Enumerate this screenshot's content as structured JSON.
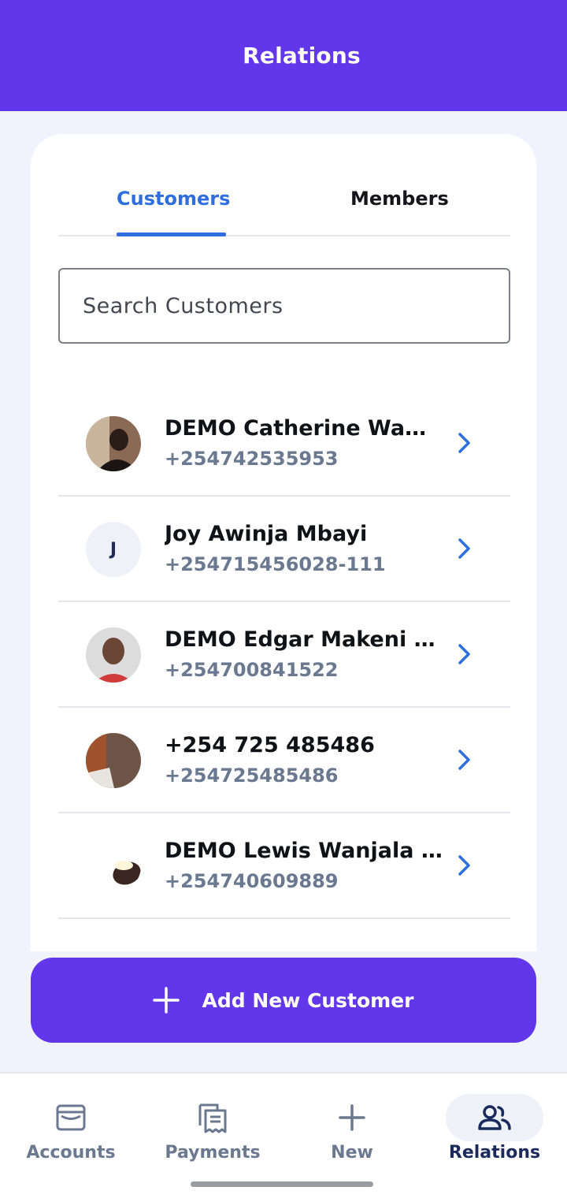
{
  "header": {
    "title": "Relations"
  },
  "tabs": [
    {
      "label": "Customers",
      "active": true
    },
    {
      "label": "Members",
      "active": false
    }
  ],
  "search": {
    "placeholder": "Search Customers",
    "value": ""
  },
  "customers": [
    {
      "name": "DEMO Catherine  Wam...",
      "phone": "+254742535953",
      "avatar": "photo"
    },
    {
      "name": "Joy Awinja Mbayi",
      "phone": "+254715456028-111",
      "avatar": "initial",
      "initial": "J"
    },
    {
      "name": "DEMO Edgar Makeni O...",
      "phone": "+254700841522",
      "avatar": "photo"
    },
    {
      "name": "+254 725 485486",
      "phone": "+254725485486",
      "avatar": "photo"
    },
    {
      "name": "DEMO Lewis Wanjala S...",
      "phone": "+254740609889",
      "avatar": "photo"
    }
  ],
  "add_button": {
    "label": "Add New Customer",
    "icon": "plus-icon"
  },
  "bottom_nav": [
    {
      "label": "Accounts",
      "icon": "wallet-icon",
      "active": false
    },
    {
      "label": "Payments",
      "icon": "receipts-icon",
      "active": false
    },
    {
      "label": "New",
      "icon": "plus-icon",
      "active": false
    },
    {
      "label": "Relations",
      "icon": "people-icon",
      "active": true
    }
  ],
  "colors": {
    "brand": "#6236ea",
    "tab_active": "#2f6fdd",
    "chevron": "#2f6fdd",
    "phone_text": "#6b7990",
    "nav_active": "#1b2a5c"
  }
}
